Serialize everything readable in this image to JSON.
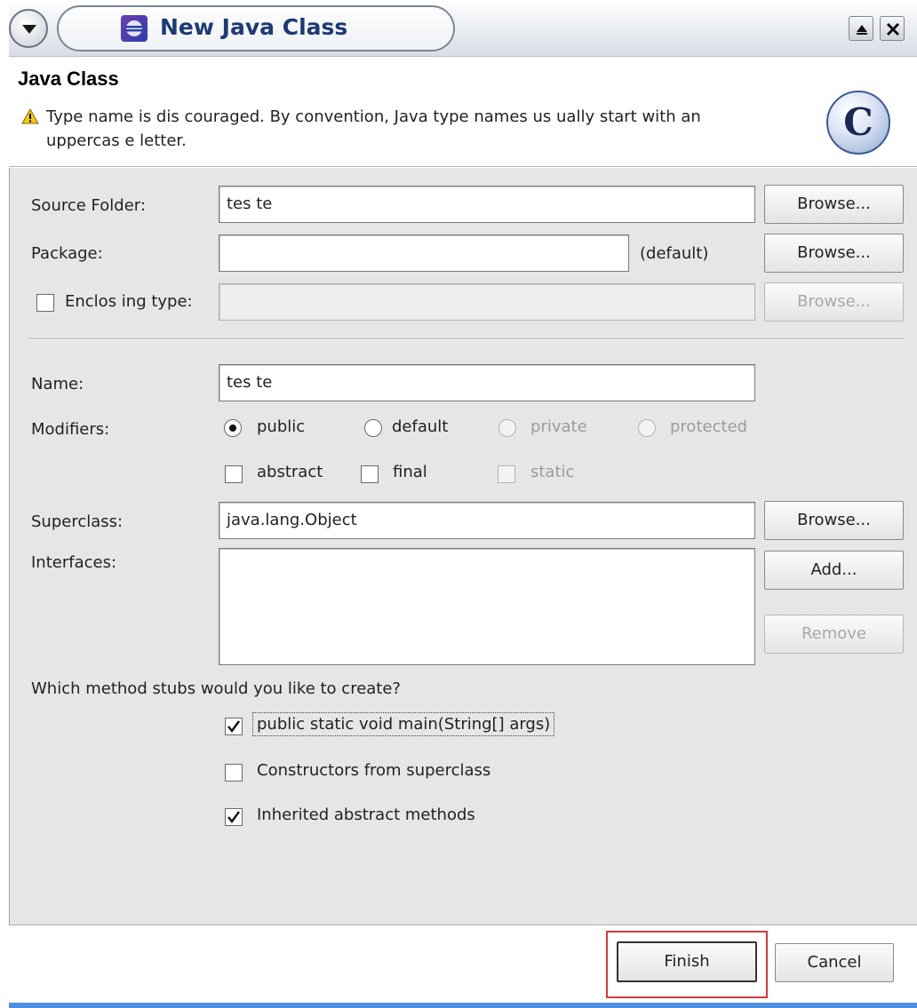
{
  "window": {
    "title": "New Java Class",
    "menu_icon": "chevron-down-icon",
    "app_icon": "eclipse-app-icon",
    "maximize_icon": "maximize-icon",
    "close_icon": "close-icon"
  },
  "header": {
    "heading": "Java Class",
    "warning_icon": "warning-icon",
    "warning_line1": "Type name is dis couraged. By convention, Java type names us ually start with an",
    "warning_line2": "uppercas e letter.",
    "class_icon_letter": "C"
  },
  "form": {
    "source_folder": {
      "label": "Source Folder:",
      "value": "tes te",
      "browse": "Browse..."
    },
    "package": {
      "label": "Package:",
      "value": "",
      "default_note": "(default)",
      "browse": "Browse..."
    },
    "enclosing_type": {
      "label": "Enclos ing type:",
      "checked": false,
      "value": "",
      "browse": "Browse..."
    },
    "name": {
      "label": "Name:",
      "value": "tes te"
    },
    "modifiers": {
      "label": "Modifiers:",
      "radios": [
        "public",
        "default",
        "private",
        "protected"
      ],
      "selected": "public",
      "checkboxes": [
        "abstract",
        "final",
        "static"
      ]
    },
    "superclass": {
      "label": "Superclass:",
      "value": "java.lang.Object",
      "browse": "Browse..."
    },
    "interfaces": {
      "label": "Interfaces:",
      "add": "Add...",
      "remove": "Remove"
    },
    "stubs": {
      "question": "Which method stubs would you like to create?",
      "options": [
        {
          "label": "public static void main(String[] args)",
          "checked": true
        },
        {
          "label": "Constructors from superclass",
          "checked": false
        },
        {
          "label": "Inherited abstract methods",
          "checked": true
        }
      ]
    }
  },
  "footer": {
    "finish": "Finish",
    "cancel": "Cancel"
  }
}
